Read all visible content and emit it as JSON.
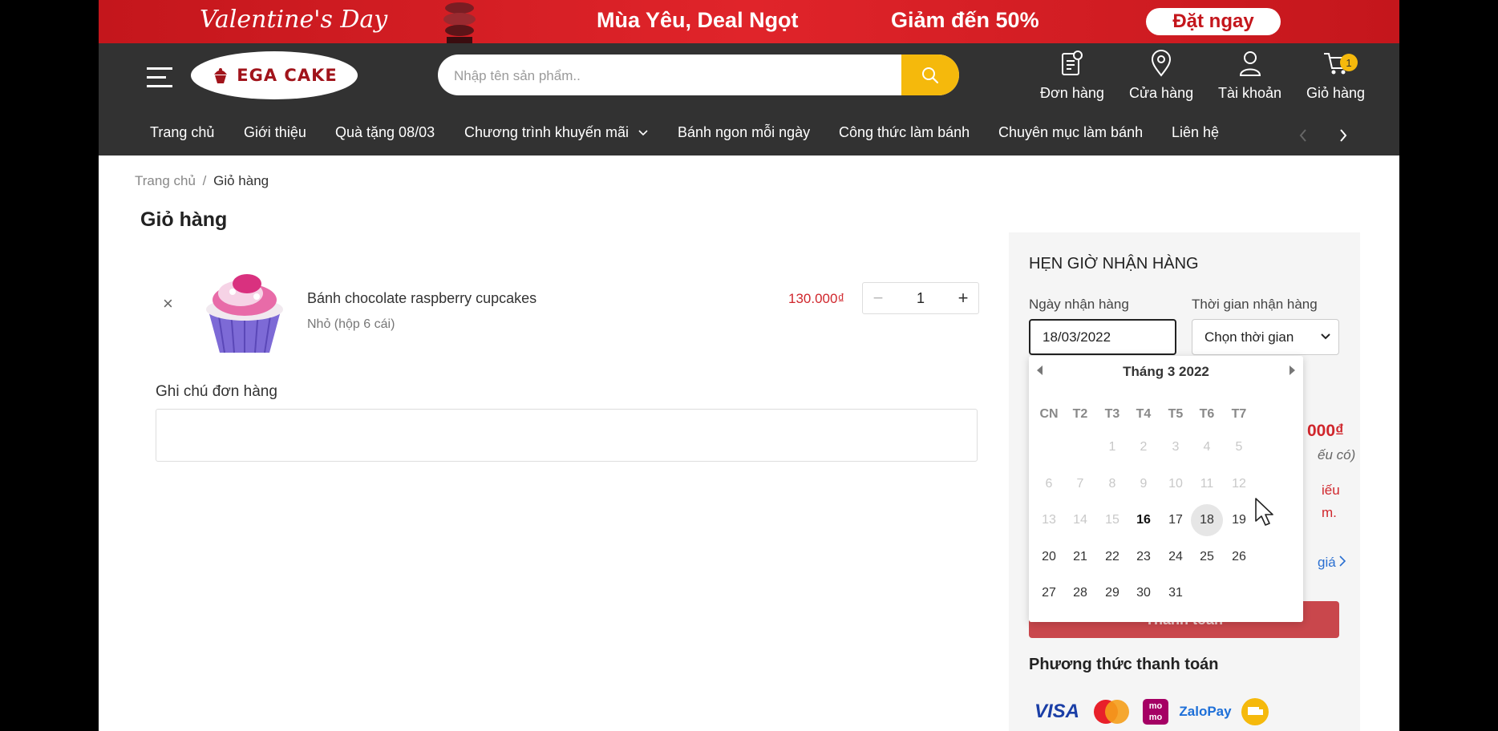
{
  "promo": {
    "valentine": "Valentine's Day",
    "slogan": "Mùa Yêu, Deal Ngọt",
    "discount": "Giảm đến 50%",
    "cta": "Đặt ngay"
  },
  "header": {
    "logo_text": "EGA CAKE",
    "search_placeholder": "Nhập tên sản phẩm..",
    "icons": {
      "orders": "Đơn hàng",
      "stores": "Cửa hàng",
      "account": "Tài khoản",
      "cart": "Giỏ hàng",
      "cart_count": "1"
    }
  },
  "nav": {
    "items": [
      "Trang chủ",
      "Giới thiệu",
      "Quà tặng 08/03",
      "Chương trình khuyến mãi",
      "Bánh ngon mỗi ngày",
      "Công thức làm bánh",
      "Chuyên mục làm bánh",
      "Liên hệ"
    ]
  },
  "breadcrumb": {
    "home": "Trang chủ",
    "sep": "/",
    "current": "Giỏ hàng"
  },
  "page_title": "Giỏ hàng",
  "cart": {
    "item": {
      "name": "Bánh chocolate raspberry cupcakes",
      "variant": "Nhỏ (hộp 6 cái)",
      "price": "130.000₫",
      "quantity": "1",
      "remove_symbol": "×",
      "minus_symbol": "−",
      "plus_symbol": "+"
    },
    "note_label": "Ghi chú đơn hàng"
  },
  "schedule": {
    "title": "HẸN GIỜ NHẬN HÀNG",
    "date_label": "Ngày nhận hàng",
    "time_label": "Thời gian nhận hàng",
    "date_value": "18/03/2022",
    "time_value": "Chọn thời gian"
  },
  "peek": {
    "total": "000₫",
    "note": "ếu có)",
    "warn1": "iếu",
    "warn2": "m.",
    "quote": "giá"
  },
  "checkout_label": "Thanh toán",
  "payment": {
    "title": "Phương thức thanh toán",
    "methods": [
      "visa",
      "mastercard",
      "momo",
      "zalopay",
      "cod"
    ],
    "visa": "VISA",
    "zalo": "ZaloPay",
    "momo": "mo mo"
  },
  "calendar": {
    "month_label": "Tháng 3",
    "year": "2022",
    "weekdays": [
      "CN",
      "T2",
      "T3",
      "T4",
      "T5",
      "T6",
      "T7"
    ],
    "weeks": [
      [
        "",
        "",
        "1",
        "2",
        "3",
        "4",
        "5"
      ],
      [
        "6",
        "7",
        "8",
        "9",
        "10",
        "11",
        "12"
      ],
      [
        "13",
        "14",
        "15",
        "16",
        "17",
        "18",
        "19"
      ],
      [
        "20",
        "21",
        "22",
        "23",
        "24",
        "25",
        "26"
      ],
      [
        "27",
        "28",
        "29",
        "30",
        "31",
        "",
        ""
      ]
    ],
    "today": "16",
    "selected": "18",
    "disabled_before": 16
  },
  "colors": {
    "brand_red": "#c4161c",
    "header_dark": "#323232",
    "accent_yellow": "#f5b90c",
    "price_red": "#d0262c"
  }
}
